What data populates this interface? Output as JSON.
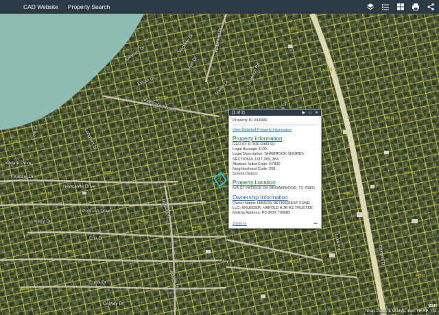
{
  "toolbar": {
    "cad_website": "CAD Website",
    "property_search": "Property Search",
    "tools": [
      "layers-icon",
      "legend-icon",
      "basemap-gallery-icon",
      "print-icon",
      "share-icon"
    ]
  },
  "map": {
    "road_labels": [
      "Shamrock Shores",
      "Kildare Drive",
      "Cork Dr",
      "Longford Dr",
      "Erin Dr",
      "Lake Rd",
      "Newcastle Drive",
      "Portrush Drive",
      "Clonmel Dr",
      "Bray Dr",
      "Dublin Dr",
      "Ennis Dr",
      "Galway Dr",
      "Naas Dr",
      "Arklow Dr",
      "Tralee Dr",
      "Kildare Dr",
      "Shannon Rd",
      "Donegal Dr",
      "Killarney Dr",
      "Wicklow Dr",
      "Waterford Dr",
      "Kerry Dr",
      "Lucan Dr"
    ],
    "lot_numbers": [
      "44745",
      "44718",
      "44702",
      "44802",
      "44708",
      "44750",
      "44760",
      "44763",
      "44811",
      "44783",
      "44806",
      "44819",
      "44736",
      "44797",
      "44807",
      "44800"
    ],
    "attribution": "Texas Parks & Wildlife, Esri, HERE, Ga",
    "colors": {
      "parcel": "#f2ef3a",
      "water": "#8ebcb3",
      "road": "#ffffff",
      "selected": "#00e5ff"
    }
  },
  "popup": {
    "counter": "(1 of 2)",
    "controls": [
      "next-icon",
      "maximize-icon",
      "close-icon"
    ],
    "property_id": "Property ID #43946",
    "view_link": "View Detailed Property Information",
    "section_info": "Property Information",
    "geo_id": "GEO ID: R7830-0383-00",
    "legal_acreage": "Legal Acreage: 0.00",
    "legal_desc": "Legal Description: SHAMROCK SHORES SECTION A, LOT 383, 384",
    "abstract": "Abstract Subd Code: R7830",
    "neighborhood": "Neighborhood Code: 208",
    "school": "School District:",
    "section_location": "Property Location",
    "location": "N/A ST PATRICK DR BROWNWOOD, TX 76801",
    "section_owner": "Ownership Information",
    "owner": "Owner Name: HINSON RETIREMENT FUND LLC; KRUEGER, HAROLD A JR AS TRUSTEE",
    "mailing": "Mailing Address: PO BOX 700582",
    "zoom_to": "Zoom to",
    "more": "•••"
  }
}
